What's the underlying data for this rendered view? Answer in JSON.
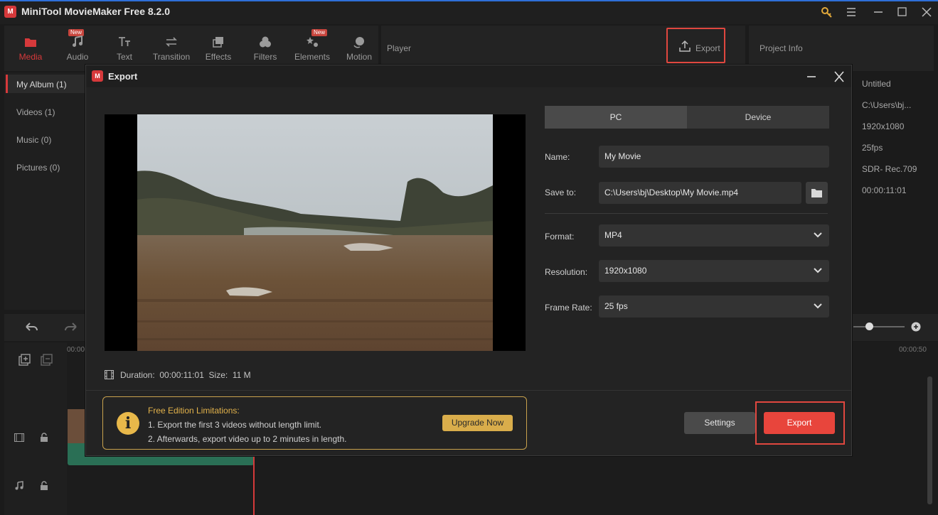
{
  "app": {
    "title": "MiniTool MovieMaker Free 8.2.0",
    "logo_text": "M"
  },
  "toolbar": {
    "items": [
      {
        "label": "Media",
        "icon": "folder-icon",
        "active": true
      },
      {
        "label": "Audio",
        "icon": "music-icon",
        "badge": "New"
      },
      {
        "label": "Text",
        "icon": "text-icon"
      },
      {
        "label": "Transition",
        "icon": "transition-icon"
      },
      {
        "label": "Effects",
        "icon": "effects-icon"
      },
      {
        "label": "Filters",
        "icon": "filters-icon"
      },
      {
        "label": "Elements",
        "icon": "elements-icon",
        "badge": "New"
      },
      {
        "label": "Motion",
        "icon": "motion-icon"
      }
    ]
  },
  "player": {
    "label": "Player",
    "export_label": "Export"
  },
  "project_info": {
    "label": "Project Info",
    "values": [
      "Untitled",
      "C:\\Users\\bj...",
      "1920x1080",
      "25fps",
      "SDR- Rec.709",
      "00:00:11:01"
    ]
  },
  "albums": [
    {
      "label": "My Album (1)",
      "active": true
    },
    {
      "label": "Videos (1)"
    },
    {
      "label": "Music (0)"
    },
    {
      "label": "Pictures (0)"
    }
  ],
  "timeline": {
    "ruler_start": "00:00",
    "ruler_end": "00:00:50"
  },
  "dialog": {
    "title": "Export",
    "logo_text": "M",
    "tabs": {
      "pc": "PC",
      "device": "Device"
    },
    "fields": {
      "name_label": "Name:",
      "name_value": "My Movie",
      "save_label": "Save to:",
      "save_value": "C:\\Users\\bj\\Desktop\\My Movie.mp4",
      "format_label": "Format:",
      "format_value": "MP4",
      "resolution_label": "Resolution:",
      "resolution_value": "1920x1080",
      "framerate_label": "Frame Rate:",
      "framerate_value": "25 fps"
    },
    "duration_text": "Duration:  00:00:11:01  Size:  11 M",
    "limits": {
      "title": "Free Edition Limitations:",
      "line1": "1. Export the first 3 videos without length limit.",
      "line2": "2. Afterwards, export video up to 2 minutes in length.",
      "upgrade": "Upgrade Now"
    },
    "settings_label": "Settings",
    "export_label": "Export"
  },
  "colors": {
    "accent": "#e8453c",
    "gold": "#d9ad4b",
    "brand": "#d6393b"
  }
}
